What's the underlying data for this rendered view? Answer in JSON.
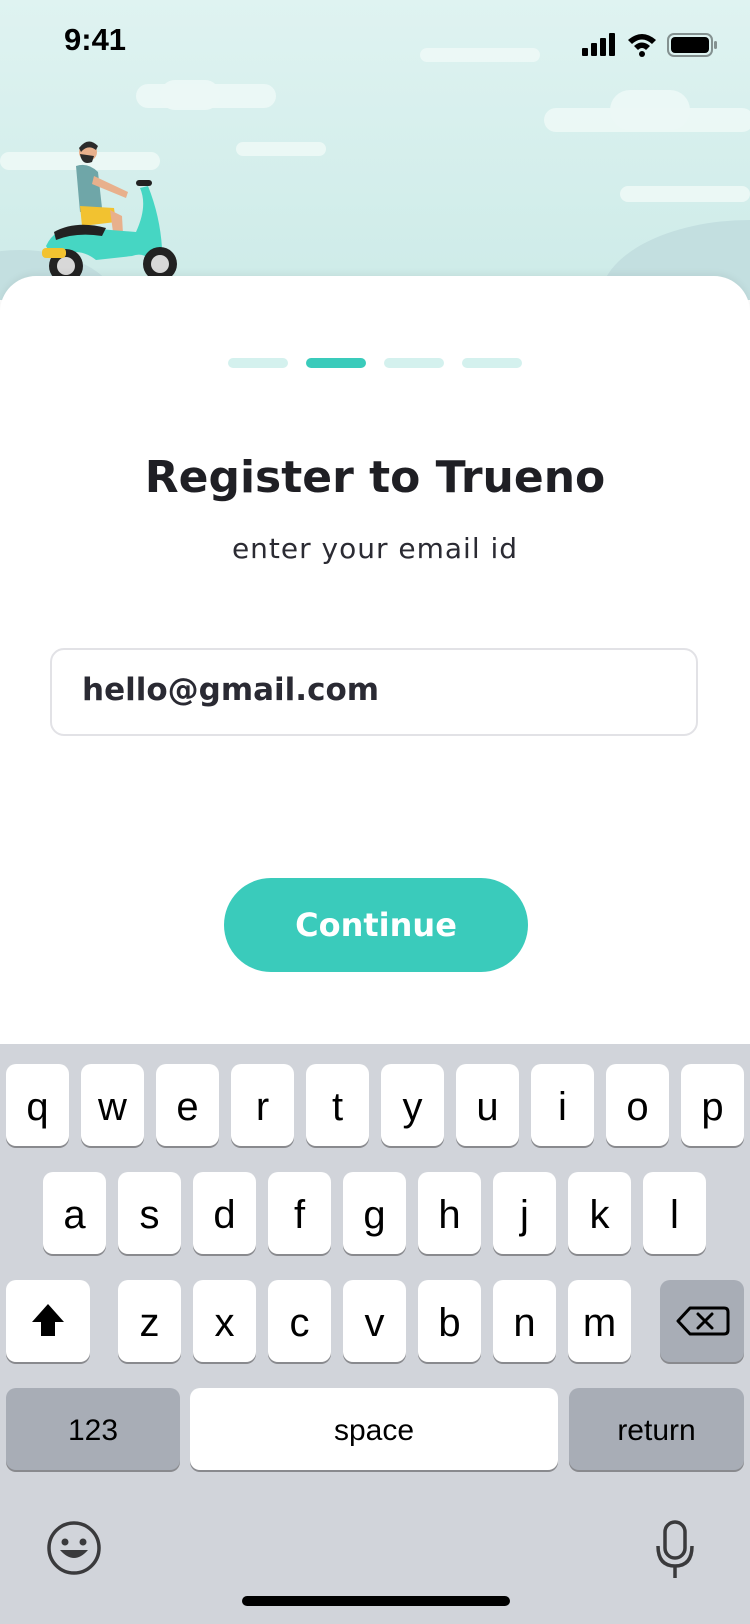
{
  "status_bar": {
    "time": "9:41"
  },
  "progress": {
    "steps": 4,
    "active_index": 1
  },
  "register": {
    "title": "Register to Trueno",
    "subtitle": "enter your email id",
    "email_value": "hello@gmail.com",
    "continue_label": "Continue"
  },
  "keyboard": {
    "row1": [
      "q",
      "w",
      "e",
      "r",
      "t",
      "y",
      "u",
      "i",
      "o",
      "p"
    ],
    "row2": [
      "a",
      "s",
      "d",
      "f",
      "g",
      "h",
      "j",
      "k",
      "l"
    ],
    "row3": [
      "z",
      "x",
      "c",
      "v",
      "b",
      "n",
      "m"
    ],
    "numbers_label": "123",
    "space_label": "space",
    "return_label": "return"
  },
  "colors": {
    "accent": "#3acbbb",
    "accent_light": "#d4f1ee",
    "keyboard_bg": "#d1d4da"
  }
}
